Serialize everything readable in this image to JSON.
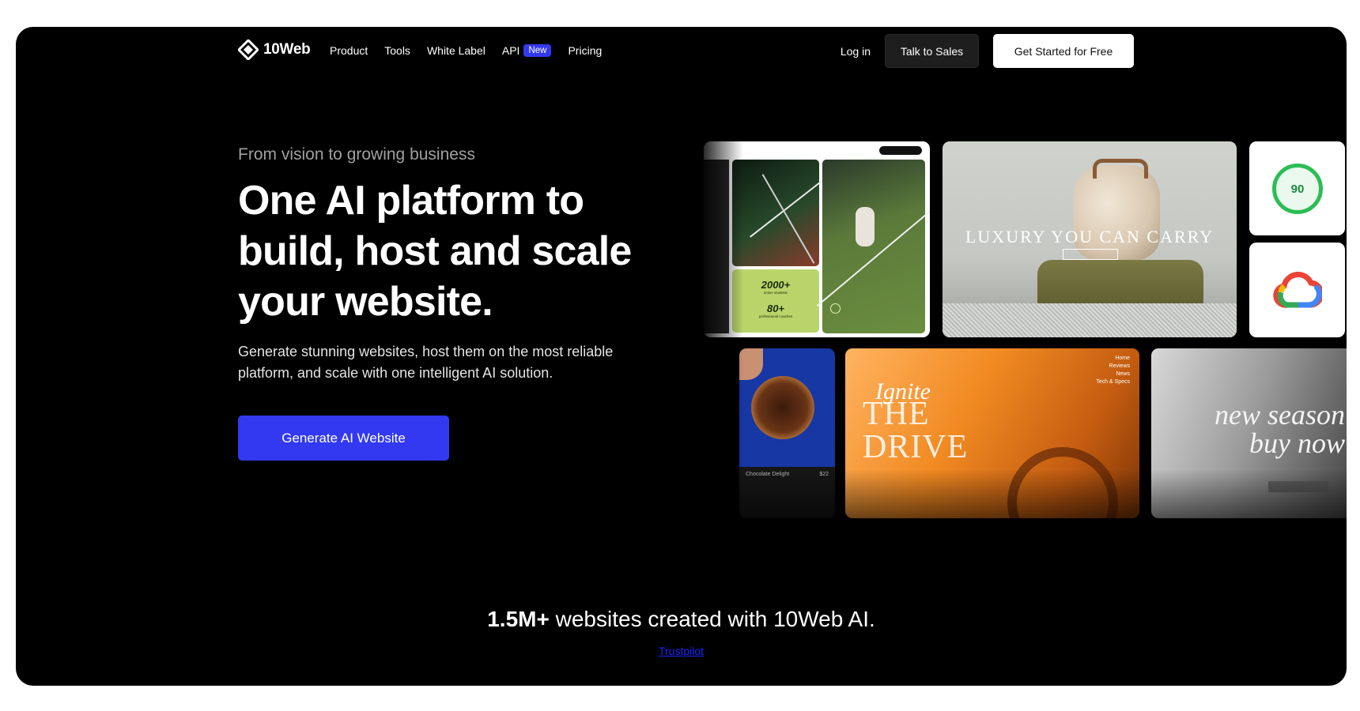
{
  "brand": {
    "name": "10Web"
  },
  "nav": {
    "links": [
      "Product",
      "Tools",
      "White Label"
    ],
    "api_label": "API",
    "api_badge": "New",
    "pricing": "Pricing",
    "login": "Log in",
    "talk_to_sales": "Talk to Sales",
    "get_started": "Get Started for Free"
  },
  "hero": {
    "eyebrow": "From vision to growing business",
    "headline": "One AI platform to build, host and scale your website.",
    "subtext": "Generate stunning websites, host them on the most reliable platform, and scale with one intelligent AI solution.",
    "cta": "Generate AI Website"
  },
  "showcase": {
    "tennis": {
      "stat1": "2000+",
      "stat1_label": "active students",
      "stat2": "80+",
      "stat2_label": "professional coaches"
    },
    "luxury": {
      "title": "LUXURY YOU CAN CARRY"
    },
    "score": {
      "value": "90"
    },
    "drive": {
      "small": "Ignite",
      "big_line1": "THE",
      "big_line2": "DRIVE",
      "menu": [
        "Home",
        "Reviews",
        "News",
        "Tech & Specs"
      ]
    },
    "dessert": {
      "name": "Chocolate Delight",
      "price": "$22"
    },
    "fashion": {
      "line1": "new season",
      "line2": "buy now"
    }
  },
  "stats": {
    "strong": "1.5M+",
    "rest": "websites created with 10Web AI."
  },
  "trustpilot": {
    "label": "Trustpilot"
  },
  "colors": {
    "accent": "#3339f1",
    "background": "#000000",
    "link": "#1a25ff"
  }
}
